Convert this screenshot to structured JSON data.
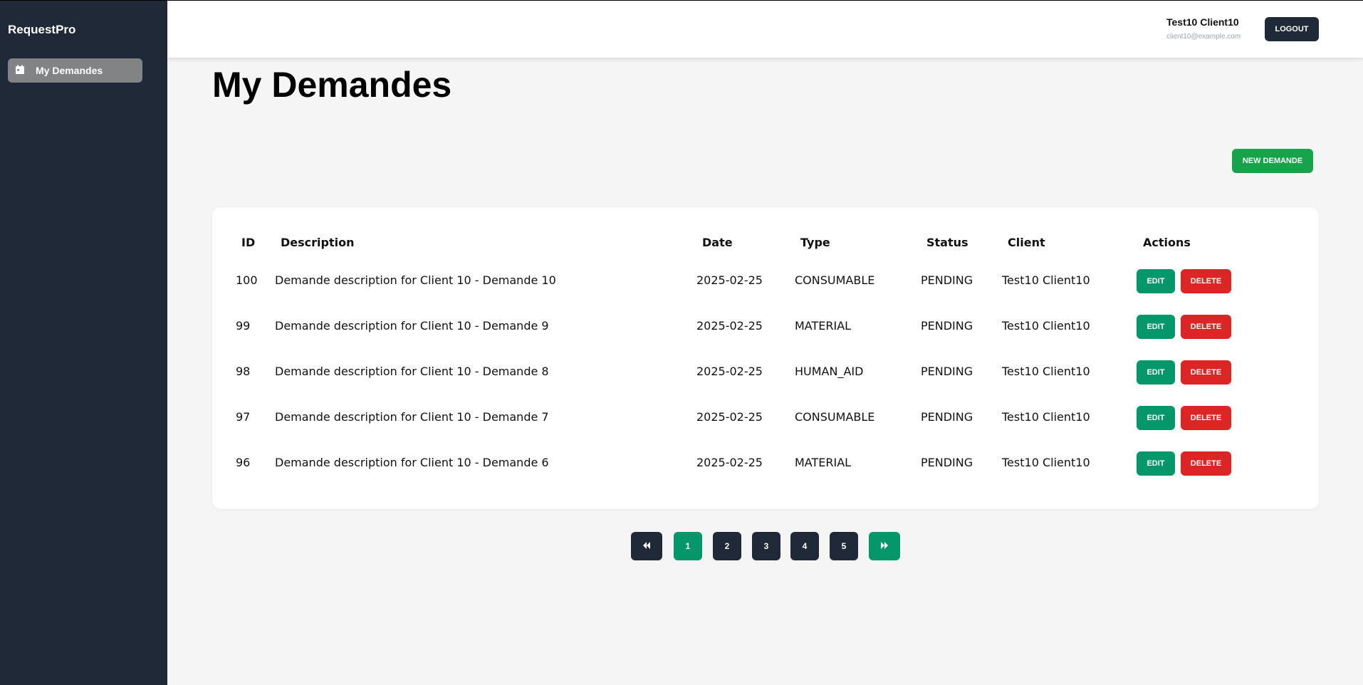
{
  "app": {
    "name": "RequestPro"
  },
  "sidebar": {
    "items": [
      {
        "label": "My Demandes",
        "icon": "calendar-icon"
      }
    ]
  },
  "header": {
    "user_name": "Test10 Client10",
    "user_email": "client10@example.com",
    "logout_label": "LOGOUT"
  },
  "page": {
    "title": "My Demandes",
    "new_button_label": "NEW DEMANDE"
  },
  "table": {
    "columns": [
      "ID",
      "Description",
      "Date",
      "Type",
      "Status",
      "Client",
      "Actions"
    ],
    "rows": [
      {
        "id": "100",
        "description": "Demande description for Client 10 - Demande 10",
        "date": "2025-02-25",
        "type": "CONSUMABLE",
        "status": "PENDING",
        "client": "Test10 Client10"
      },
      {
        "id": "99",
        "description": "Demande description for Client 10 - Demande 9",
        "date": "2025-02-25",
        "type": "MATERIAL",
        "status": "PENDING",
        "client": "Test10 Client10"
      },
      {
        "id": "98",
        "description": "Demande description for Client 10 - Demande 8",
        "date": "2025-02-25",
        "type": "HUMAN_AID",
        "status": "PENDING",
        "client": "Test10 Client10"
      },
      {
        "id": "97",
        "description": "Demande description for Client 10 - Demande 7",
        "date": "2025-02-25",
        "type": "CONSUMABLE",
        "status": "PENDING",
        "client": "Test10 Client10"
      },
      {
        "id": "96",
        "description": "Demande description for Client 10 - Demande 6",
        "date": "2025-02-25",
        "type": "MATERIAL",
        "status": "PENDING",
        "client": "Test10 Client10"
      }
    ],
    "edit_label": "EDIT",
    "delete_label": "DELETE"
  },
  "pagination": {
    "first_icon": "double-chevron-left-icon",
    "pages": [
      "1",
      "2",
      "3",
      "4",
      "5"
    ],
    "current": "1",
    "last_icon": "double-chevron-right-icon"
  },
  "colors": {
    "sidebar": "#1f2937",
    "primary_dark": "#1f2937",
    "edit": "#059669",
    "delete": "#dc2626",
    "new": "#16a34a",
    "active_page": "#059669"
  }
}
